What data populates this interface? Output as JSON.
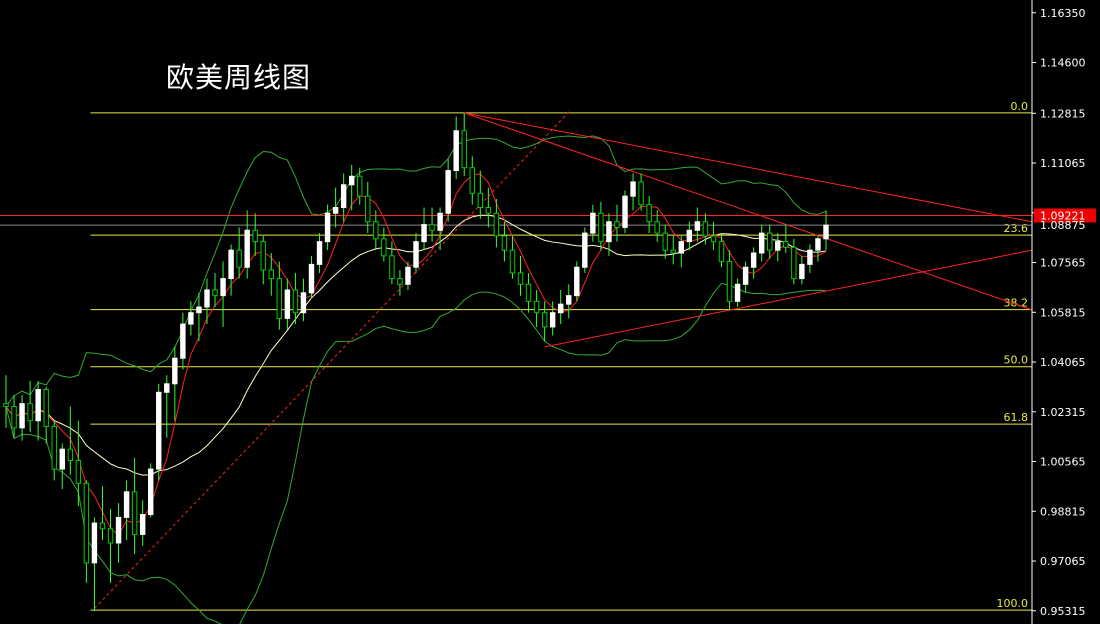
{
  "title": "欧美周线图",
  "chart_data": {
    "type": "candlestick",
    "title": "欧美周线图",
    "y_axis": {
      "range": [
        0.9485,
        1.168
      ],
      "ticks": [
        "1.16350",
        "1.14600",
        "1.12815",
        "1.11065",
        "1.09315",
        "1.07565",
        "1.05815",
        "1.04065",
        "1.02315",
        "1.00565",
        "0.98815",
        "0.97065",
        "0.95315"
      ]
    },
    "fib_levels": [
      {
        "label": "0.0",
        "price": 1.1283
      },
      {
        "label": "23.6",
        "price": 1.0853
      },
      {
        "label": "38.2",
        "price": 1.0591
      },
      {
        "label": "50.0",
        "price": 1.039
      },
      {
        "label": "61.8",
        "price": 1.0188
      },
      {
        "label": "100.0",
        "price": 0.9534
      }
    ],
    "current_price": {
      "label": "1.09221",
      "price": 1.0922
    },
    "last_price": {
      "label": "1.08875",
      "price": 1.0888
    },
    "colors": {
      "background": "#000000",
      "bull_candle": "#ffffff",
      "bear_candle": "#00cc00",
      "wick": "#33ff33",
      "fib": "#e8e84a",
      "trendline": "#ff2222",
      "bollinger": "#33aa33",
      "ma_fast": "#ff2222",
      "ma_slow": "#ffffcc",
      "price_tag": "#ee0000"
    },
    "candles": [
      [
        1.026,
        1.036,
        1.0175,
        1.025
      ],
      [
        1.025,
        1.029,
        1.014,
        1.0175
      ],
      [
        1.0175,
        1.029,
        1.013,
        1.026
      ],
      [
        1.026,
        1.034,
        1.016,
        1.02
      ],
      [
        1.02,
        1.034,
        1.013,
        1.031
      ],
      [
        1.031,
        1.032,
        1.012,
        1.018
      ],
      [
        1.018,
        1.02,
        0.999,
        1.003
      ],
      [
        1.003,
        1.012,
        0.996,
        1.01
      ],
      [
        1.01,
        1.025,
        1.001,
        1.006
      ],
      [
        1.006,
        1.02,
        0.99,
        0.998
      ],
      [
        0.998,
        0.999,
        0.963,
        0.97
      ],
      [
        0.97,
        0.986,
        0.953,
        0.984
      ],
      [
        0.984,
        0.997,
        0.978,
        0.982
      ],
      [
        0.982,
        0.989,
        0.963,
        0.977
      ],
      [
        0.977,
        0.991,
        0.97,
        0.986
      ],
      [
        0.986,
        0.999,
        0.978,
        0.995
      ],
      [
        0.995,
        1.007,
        0.973,
        0.98
      ],
      [
        0.98,
        0.992,
        0.976,
        0.987
      ],
      [
        0.987,
        1.005,
        0.986,
        1.003
      ],
      [
        1.003,
        1.033,
        0.999,
        1.03
      ],
      [
        1.03,
        1.036,
        1.014,
        1.033
      ],
      [
        1.033,
        1.046,
        1.02,
        1.042
      ],
      [
        1.042,
        1.058,
        1.038,
        1.054
      ],
      [
        1.054,
        1.062,
        1.05,
        1.058
      ],
      [
        1.058,
        1.065,
        1.048,
        1.06
      ],
      [
        1.06,
        1.07,
        1.054,
        1.066
      ],
      [
        1.066,
        1.072,
        1.06,
        1.064
      ],
      [
        1.064,
        1.076,
        1.053,
        1.07
      ],
      [
        1.07,
        1.082,
        1.064,
        1.08
      ],
      [
        1.08,
        1.088,
        1.07,
        1.074
      ],
      [
        1.074,
        1.094,
        1.07,
        1.087
      ],
      [
        1.087,
        1.093,
        1.078,
        1.083
      ],
      [
        1.083,
        1.085,
        1.068,
        1.073
      ],
      [
        1.073,
        1.079,
        1.064,
        1.07
      ],
      [
        1.07,
        1.076,
        1.052,
        1.056
      ],
      [
        1.056,
        1.07,
        1.052,
        1.066
      ],
      [
        1.066,
        1.072,
        1.054,
        1.058
      ],
      [
        1.058,
        1.07,
        1.055,
        1.065
      ],
      [
        1.065,
        1.078,
        1.063,
        1.075
      ],
      [
        1.075,
        1.086,
        1.072,
        1.083
      ],
      [
        1.083,
        1.096,
        1.08,
        1.093
      ],
      [
        1.093,
        1.102,
        1.088,
        1.095
      ],
      [
        1.095,
        1.107,
        1.09,
        1.103
      ],
      [
        1.103,
        1.11,
        1.094,
        1.106
      ],
      [
        1.106,
        1.109,
        1.096,
        1.099
      ],
      [
        1.099,
        1.104,
        1.086,
        1.09
      ],
      [
        1.09,
        1.094,
        1.08,
        1.084
      ],
      [
        1.084,
        1.088,
        1.076,
        1.078
      ],
      [
        1.078,
        1.083,
        1.068,
        1.07
      ],
      [
        1.07,
        1.073,
        1.064,
        1.068
      ],
      [
        1.068,
        1.076,
        1.066,
        1.074
      ],
      [
        1.074,
        1.086,
        1.072,
        1.083
      ],
      [
        1.083,
        1.095,
        1.08,
        1.089
      ],
      [
        1.089,
        1.095,
        1.083,
        1.087
      ],
      [
        1.087,
        1.095,
        1.08,
        1.093
      ],
      [
        1.093,
        1.112,
        1.09,
        1.108
      ],
      [
        1.108,
        1.127,
        1.105,
        1.122
      ],
      [
        1.122,
        1.1283,
        1.106,
        1.109
      ],
      [
        1.109,
        1.113,
        1.096,
        1.1
      ],
      [
        1.1,
        1.108,
        1.091,
        1.095
      ],
      [
        1.095,
        1.102,
        1.088,
        1.093
      ],
      [
        1.093,
        1.098,
        1.081,
        1.085
      ],
      [
        1.085,
        1.09,
        1.076,
        1.08
      ],
      [
        1.08,
        1.085,
        1.07,
        1.072
      ],
      [
        1.072,
        1.078,
        1.064,
        1.068
      ],
      [
        1.068,
        1.072,
        1.058,
        1.062
      ],
      [
        1.062,
        1.066,
        1.053,
        1.058
      ],
      [
        1.058,
        1.062,
        1.048,
        1.053
      ],
      [
        1.053,
        1.062,
        1.05,
        1.058
      ],
      [
        1.058,
        1.066,
        1.054,
        1.061
      ],
      [
        1.061,
        1.068,
        1.056,
        1.064
      ],
      [
        1.064,
        1.076,
        1.062,
        1.074
      ],
      [
        1.074,
        1.088,
        1.072,
        1.086
      ],
      [
        1.086,
        1.096,
        1.083,
        1.093
      ],
      [
        1.093,
        1.097,
        1.08,
        1.083
      ],
      [
        1.083,
        1.093,
        1.078,
        1.09
      ],
      [
        1.09,
        1.096,
        1.083,
        1.088
      ],
      [
        1.088,
        1.101,
        1.086,
        1.099
      ],
      [
        1.099,
        1.107,
        1.094,
        1.104
      ],
      [
        1.104,
        1.107,
        1.094,
        1.096
      ],
      [
        1.096,
        1.099,
        1.086,
        1.09
      ],
      [
        1.09,
        1.094,
        1.083,
        1.086
      ],
      [
        1.086,
        1.089,
        1.077,
        1.08
      ],
      [
        1.08,
        1.085,
        1.075,
        1.079
      ],
      [
        1.079,
        1.085,
        1.074,
        1.083
      ],
      [
        1.083,
        1.09,
        1.08,
        1.087
      ],
      [
        1.087,
        1.095,
        1.083,
        1.09
      ],
      [
        1.09,
        1.093,
        1.082,
        1.085
      ],
      [
        1.085,
        1.09,
        1.08,
        1.083
      ],
      [
        1.083,
        1.086,
        1.074,
        1.076
      ],
      [
        1.076,
        1.08,
        1.059,
        1.062
      ],
      [
        1.062,
        1.07,
        1.06,
        1.068
      ],
      [
        1.068,
        1.076,
        1.065,
        1.074
      ],
      [
        1.074,
        1.081,
        1.07,
        1.079
      ],
      [
        1.079,
        1.089,
        1.076,
        1.086
      ],
      [
        1.086,
        1.089,
        1.077,
        1.08
      ],
      [
        1.08,
        1.086,
        1.076,
        1.083
      ],
      [
        1.083,
        1.089,
        1.079,
        1.081
      ],
      [
        1.081,
        1.084,
        1.068,
        1.07
      ],
      [
        1.07,
        1.078,
        1.068,
        1.075
      ],
      [
        1.075,
        1.082,
        1.072,
        1.08
      ],
      [
        1.08,
        1.085,
        1.076,
        1.084
      ],
      [
        1.084,
        1.094,
        1.08,
        1.0888
      ]
    ]
  }
}
